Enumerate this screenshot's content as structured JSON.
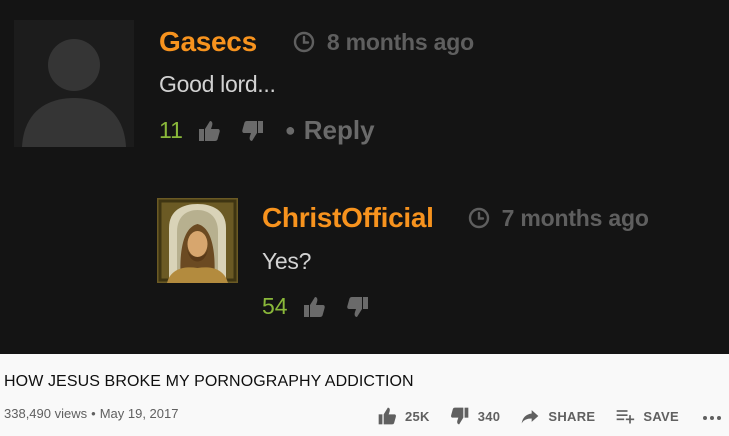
{
  "comments": [
    {
      "username": "Gasecs",
      "time": "8 months ago",
      "text": "Good lord...",
      "likes": "11",
      "reply_label": "Reply",
      "avatar_icon": "default-user-silhouette"
    },
    {
      "username": "ChristOfficial",
      "time": "7 months ago",
      "text": "Yes?",
      "likes": "54",
      "avatar_icon": "jesus-portrait"
    }
  ],
  "video": {
    "title": "HOW JESUS BROKE MY PORNOGRAPHY ADDICTION",
    "views": "338,490 views",
    "separator": "•",
    "date": "May 19, 2017",
    "actions": {
      "like_count": "25K",
      "dislike_count": "340",
      "share_label": "SHARE",
      "save_label": "SAVE"
    }
  },
  "colors": {
    "username": "#f7931e",
    "like_count": "#8ab83a",
    "comment_bg": "#141414",
    "info_bg": "#f9f9f9"
  }
}
